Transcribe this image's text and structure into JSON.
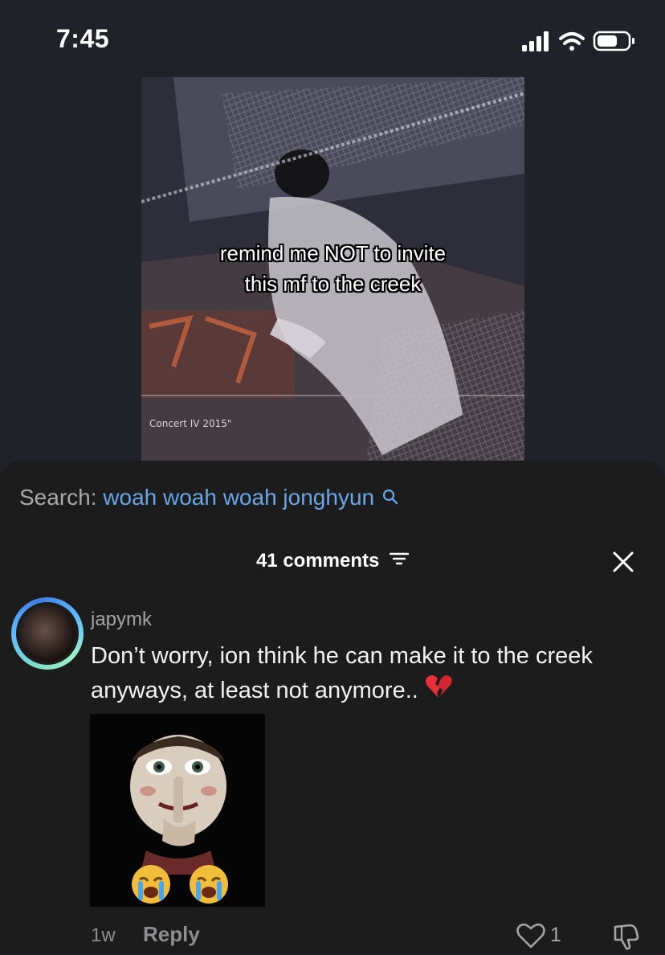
{
  "status_bar": {
    "time": "7:45"
  },
  "video": {
    "caption_line1": "remind me NOT to invite",
    "caption_line2": "this mf to the creek",
    "watermark": "Concert IV 2015\""
  },
  "search": {
    "prefix": "Search:",
    "term": "woah woah woah jonghyun"
  },
  "comments": {
    "count_label": "41 comments",
    "items": [
      {
        "username": "japymk",
        "text": "Don’t worry, ion think he can make it to the creek anyways, at least not anymore..",
        "emoji": "broken-heart",
        "image_emoji": [
          "loudly-crying-face",
          "loudly-crying-face"
        ],
        "age": "1w",
        "reply_label": "Reply",
        "likes": "1"
      }
    ]
  },
  "colors": {
    "accent_blue": "#6aa6e6",
    "sheet_bg": "#1c1c1d",
    "page_bg": "#1f2228"
  }
}
